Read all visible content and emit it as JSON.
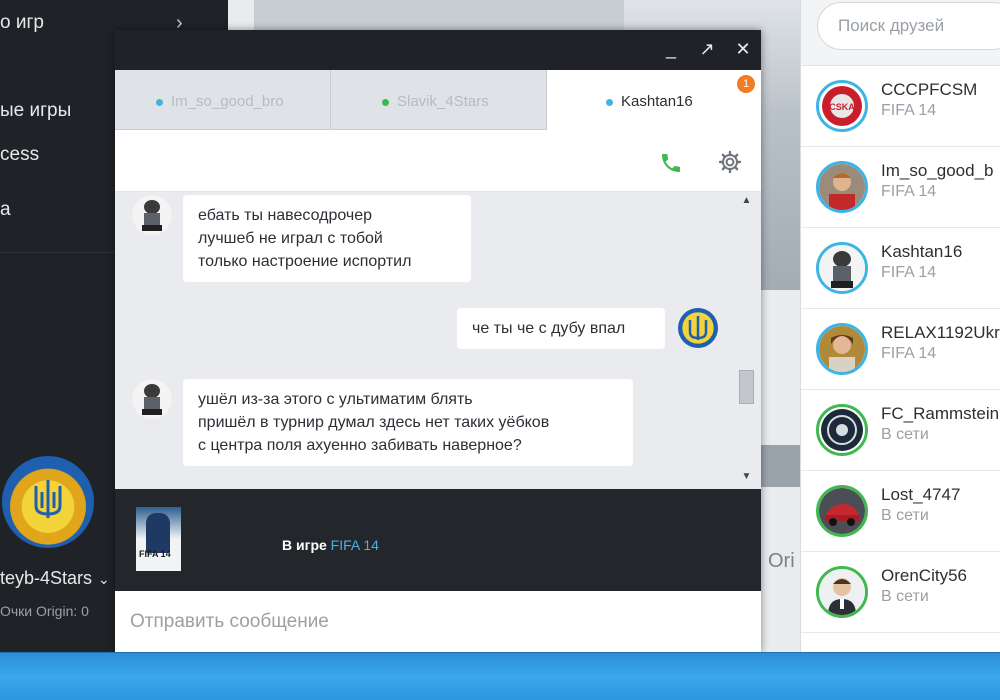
{
  "sidebar": {
    "items": [
      {
        "label": "о игр"
      },
      {
        "label": "ые игры"
      },
      {
        "label": "cess"
      },
      {
        "label": "а"
      }
    ],
    "username": "teyb-4Stars",
    "points": "Очки Origin: 0"
  },
  "background": {
    "origin_fragment": "Ori"
  },
  "chat": {
    "tabs": [
      {
        "label": "Im_so_good_bro",
        "dot_color": "#3cb4e5"
      },
      {
        "label": "Slavik_4Stars",
        "dot_color": "#3fb94f"
      },
      {
        "label": "Kashtan16",
        "dot_color": "#3cb4e5"
      }
    ],
    "unread_badge": "1",
    "messages": [
      {
        "from": "Kashtan16",
        "lines": [
          "ебать ты навесодрочер",
          "лучшеб не играл с тобой",
          "только настроение испортил"
        ]
      },
      {
        "from": "me",
        "lines": [
          "че ты че с дубу впал"
        ]
      },
      {
        "from": "Kashtan16",
        "lines": [
          "ушёл из-за этого с ультиматим блять",
          "пришёл в турнир думал здесь нет таких уёбков",
          "с центра поля ахуенно забивать наверное?"
        ]
      }
    ],
    "status": {
      "prefix": "В игре",
      "game": "FIFA 14",
      "cover_label": "FIFA 14"
    },
    "input_placeholder": "Отправить сообщение"
  },
  "friends": {
    "search_placeholder": "Поиск друзей",
    "list": [
      {
        "name": "CCCPFCSM",
        "status": "FIFA 14",
        "presence": "in-game"
      },
      {
        "name": "Im_so_good_b",
        "status": "FIFA 14",
        "presence": "in-game"
      },
      {
        "name": "Kashtan16",
        "status": "FIFA 14",
        "presence": "in-game"
      },
      {
        "name": "RELAX1192Ukr",
        "status": "FIFA 14",
        "presence": "in-game"
      },
      {
        "name": "FC_Rammstein",
        "status": "В сети",
        "presence": "online"
      },
      {
        "name": "Lost_4747",
        "status": "В сети",
        "presence": "online"
      },
      {
        "name": "OrenCity56",
        "status": "В сети",
        "presence": "online"
      }
    ]
  },
  "colors": {
    "accent": "#3cb4e5",
    "online": "#3fb94f",
    "badge": "#f37b21",
    "link": "#4ab0e4"
  }
}
